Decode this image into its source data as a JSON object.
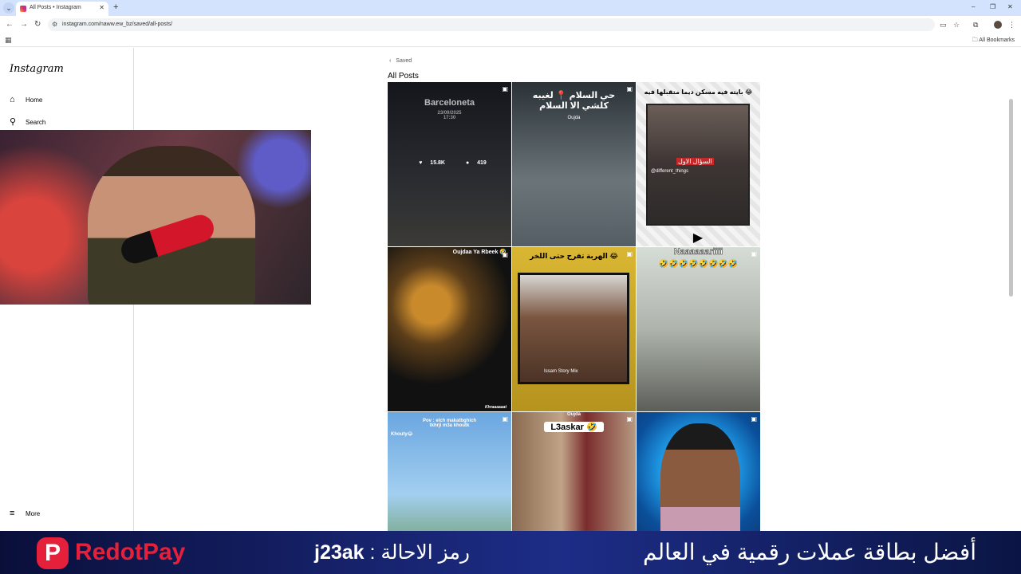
{
  "browser": {
    "tab_title": "All Posts • Instagram",
    "url": "instagram.com/naww.ew_bz/saved/all-posts/",
    "all_bookmarks": "All Bookmarks"
  },
  "sidebar": {
    "logo": "Instagram",
    "items": [
      {
        "label": "Home",
        "icon": "home-icon"
      },
      {
        "label": "Search",
        "icon": "search-icon"
      }
    ],
    "more": "More"
  },
  "main": {
    "back_label": "Saved",
    "title": "All Posts",
    "posts": [
      {
        "caption": "Barceloneta",
        "sub": "23/09/2025\n17:30",
        "likes": "15.8K",
        "comments": "419"
      },
      {
        "caption": "حي السلام 📍 لغيبه\nكلشي الا السلام",
        "sub": "Oujda"
      },
      {
        "caption": "بايته فيه مسكن ديما متقبلها فيه 😂",
        "sub": "السؤال الاول",
        "tag": "@different_things"
      },
      {
        "caption": "Oujdaa Ya Rbeek 🤣",
        "sub": "Khraaaaaat"
      },
      {
        "caption": "الهربة تفرح حتى اللخر 😂",
        "sub": "Issam Story Mix"
      },
      {
        "caption": "Naaaaaariiii",
        "sub": "🤣🤣🤣🤣🤣🤣🤣🤣"
      },
      {
        "caption": "Pov : elch makatbghich\ntkhrji m3a khoutk",
        "sub": "Khouty😂"
      },
      {
        "caption": "L3askar 🤣",
        "sub": "Oujda"
      },
      {
        "caption": ""
      }
    ]
  },
  "ad": {
    "brand": "RedotPay",
    "ref_code": "j23ak",
    "ref_label": ": رمز الاحالة",
    "slogan": "أفضل بطاقة عملات رقمية في العالم"
  }
}
